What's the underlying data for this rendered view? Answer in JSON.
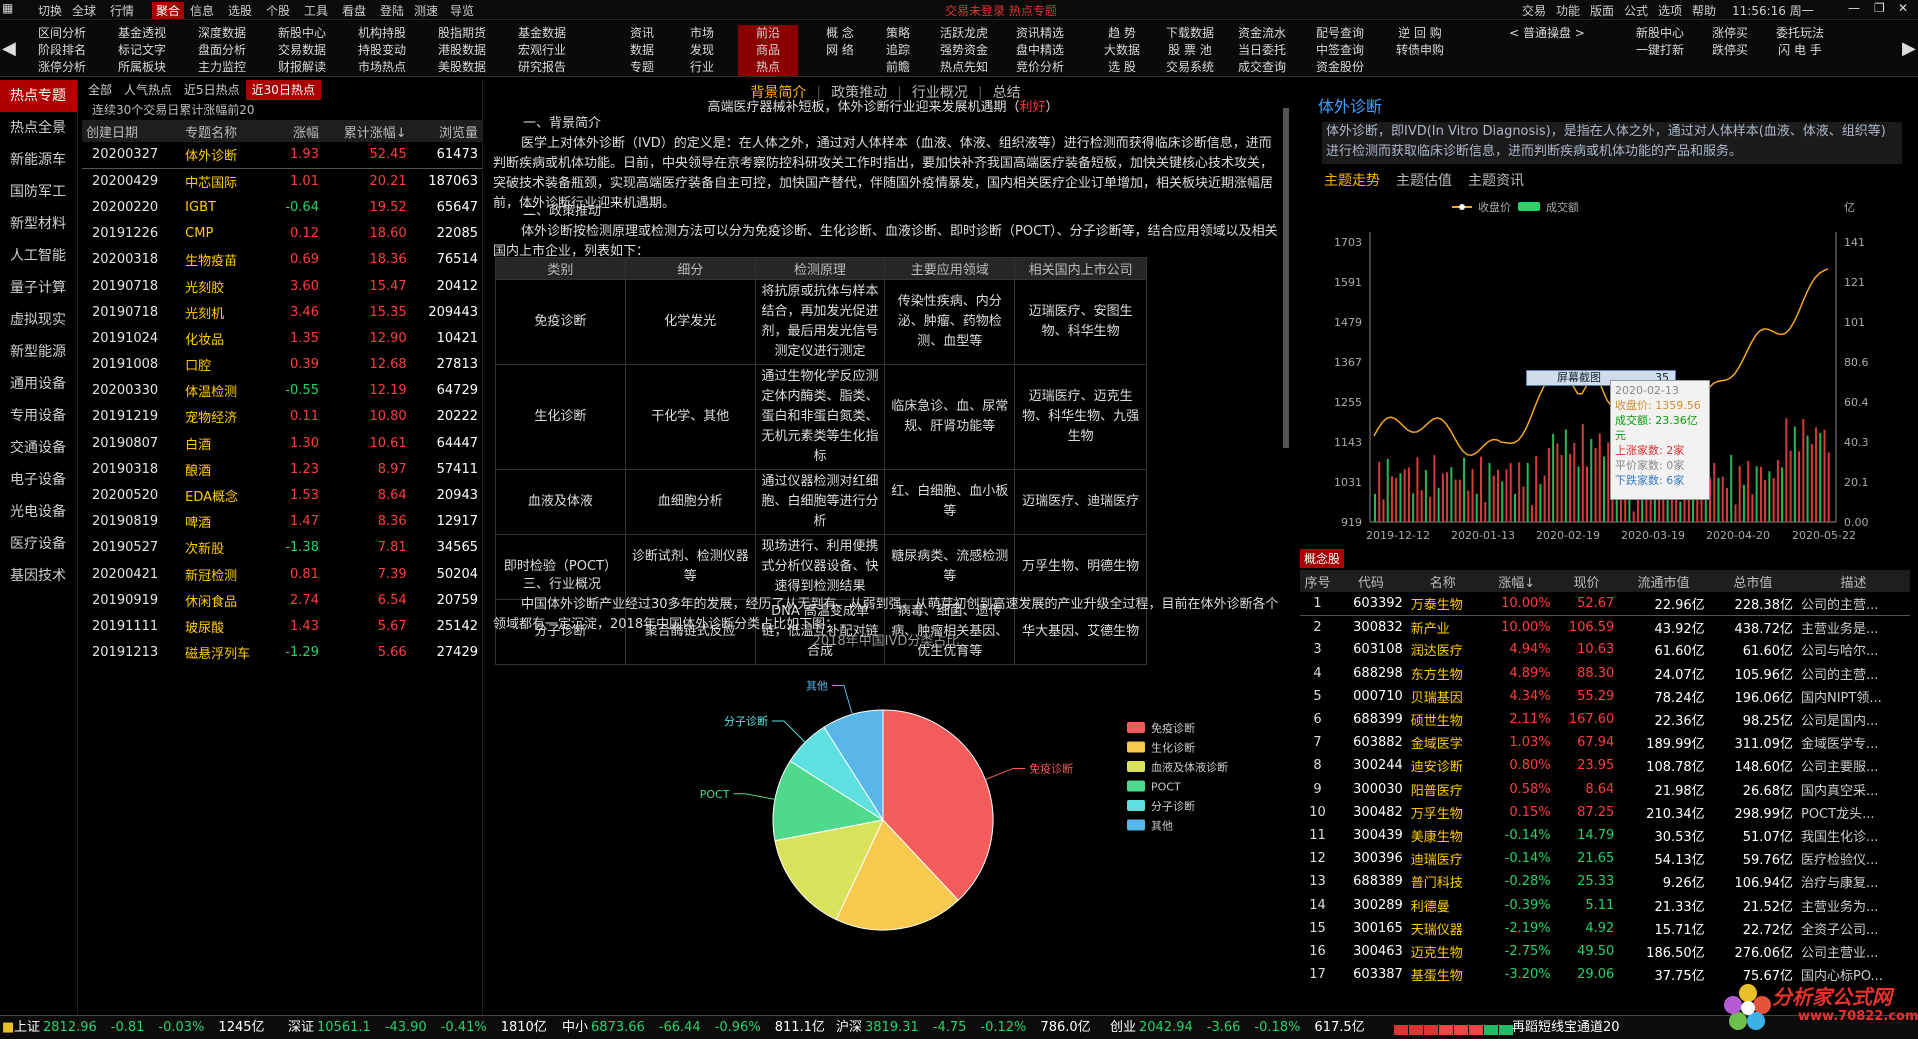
{
  "menubar": {
    "items": [
      "切换",
      "全球",
      "行情",
      "聚合",
      "信息",
      "选股",
      "个股",
      "工具",
      "看盘",
      "登陆",
      "测速",
      "导览"
    ],
    "active": 3,
    "center": "交易未登录  热点专题",
    "right": [
      "交易",
      "功能",
      "版面",
      "公式",
      "选项",
      "帮助"
    ],
    "clock": "11:56:16 周一"
  },
  "toolbar": {
    "columns": [
      [
        "区间分析",
        "阶段排名",
        "涨停分析"
      ],
      [
        "基金透视",
        "标记文字",
        "所属板块"
      ],
      [
        "深度数据",
        "盘面分析",
        "主力监控"
      ],
      [
        "新股中心",
        "交易数据",
        "财报解读"
      ],
      [
        "机构持股",
        "持股变动",
        "市场热点"
      ],
      [
        "股指期货",
        "港股数据",
        "美股数据"
      ],
      [
        "基金数据",
        "宏观行业",
        "研究报告"
      ],
      [
        "资讯",
        "数据",
        "专题"
      ],
      [
        "市场",
        "发现",
        "行业"
      ],
      [
        "前沿",
        "商品",
        "热点"
      ],
      [
        "概 念",
        "网 络",
        ""
      ],
      [
        "策略",
        "追踪",
        "前瞻"
      ],
      [
        "活跃龙虎",
        "强势资金",
        "热点先知"
      ],
      [
        "资讯精选",
        "盘中精选",
        "竞价分析"
      ],
      [
        "趋 势",
        "大数据",
        "选 股"
      ],
      [
        "下载数据",
        "股 票 池",
        "交易系统"
      ],
      [
        "资金流水",
        "当日委托",
        "成交查询"
      ],
      [
        "配号查询",
        "中签查询",
        "资金股份"
      ],
      [
        "逆 回 购",
        "转债申购",
        ""
      ],
      [
        "< 普通操盘 >",
        "",
        ""
      ],
      [
        "新股中心",
        "一键打新",
        ""
      ],
      [
        "涨停买",
        "跌停买",
        ""
      ],
      [
        "委托玩法",
        "闪 电 手",
        ""
      ]
    ],
    "hot_label": "热点"
  },
  "leftnav": {
    "items": [
      "热点专题",
      "热点全景",
      "新能源车",
      "国防军工",
      "新型材料",
      "人工智能",
      "量子计算",
      "虚拟现实",
      "新型能源",
      "通用设备",
      "专用设备",
      "交通设备",
      "电子设备",
      "光电设备",
      "医疗设备",
      "基因技术"
    ],
    "active": 0
  },
  "topics": {
    "tabs": [
      "全部",
      "人气热点",
      "近5日热点",
      "近30日热点"
    ],
    "active_tab": 3,
    "caption": "连续30个交易日累计涨幅前20",
    "headers": [
      "创建日期",
      "专题名称",
      "涨幅",
      "累计涨幅↓",
      "浏览量"
    ],
    "rows": [
      [
        "20200327",
        "体外诊断",
        "1.93",
        "52.45",
        "61473"
      ],
      [
        "20200429",
        "中芯国际",
        "1.01",
        "20.21",
        "187063"
      ],
      [
        "20200220",
        "IGBT",
        "-0.64",
        "19.52",
        "65647"
      ],
      [
        "20191226",
        "CMP",
        "0.12",
        "18.60",
        "22085"
      ],
      [
        "20200318",
        "生物疫苗",
        "0.69",
        "18.36",
        "76514"
      ],
      [
        "20190718",
        "光刻胶",
        "3.60",
        "15.47",
        "20412"
      ],
      [
        "20190718",
        "光刻机",
        "3.46",
        "15.35",
        "209443"
      ],
      [
        "20191024",
        "化妆品",
        "1.35",
        "12.90",
        "10421"
      ],
      [
        "20191008",
        "口腔",
        "0.39",
        "12.68",
        "27813"
      ],
      [
        "20200330",
        "体温检测",
        "-0.55",
        "12.19",
        "64729"
      ],
      [
        "20191219",
        "宠物经济",
        "0.11",
        "10.80",
        "20222"
      ],
      [
        "20190807",
        "白酒",
        "1.30",
        "10.61",
        "64447"
      ],
      [
        "20190318",
        "酿酒",
        "1.23",
        "8.97",
        "57411"
      ],
      [
        "20200520",
        "EDA概念",
        "1.53",
        "8.64",
        "20943"
      ],
      [
        "20190819",
        "啤酒",
        "1.47",
        "8.36",
        "12917"
      ],
      [
        "20190527",
        "次新股",
        "-1.38",
        "7.81",
        "34565"
      ],
      [
        "20200421",
        "新冠检测",
        "0.81",
        "7.39",
        "50204"
      ],
      [
        "20190919",
        "休闲食品",
        "2.74",
        "6.54",
        "20759"
      ],
      [
        "20191111",
        "玻尿酸",
        "1.43",
        "5.67",
        "25142"
      ],
      [
        "20191213",
        "磁悬浮列车",
        "-1.29",
        "5.66",
        "27429"
      ]
    ]
  },
  "article": {
    "tabs": [
      "背景简介",
      "政策推动",
      "行业概况",
      "总结"
    ],
    "active_tab": 0,
    "headline": "高端医疗器械补短板，体外诊断行业迎来发展机遇期（",
    "headline_tag": "利好",
    "headline_end": "）",
    "s1": "一、背景简介",
    "p1": "医学上对体外诊断（IVD）的定义是：在人体之外，通过对人体样本（血液、体液、组织液等）进行检测而获得临床诊断信息，进而判断疾病或机体功能。日前，中央领导在京考察防控科研攻关工作时指出，要加快补齐我国高端医疗装备短板，加快关键核心技术攻关，突破技术装备瓶颈，实现高端医疗装备自主可控，加快国产替代，伴随国外疫情暴发，国内相关医疗企业订单增加，相关板块近期涨幅居前，体外诊断行业迎来机遇期。",
    "s2": "二、政策推动",
    "p2": "体外诊断按检测原理或检测方法可以分为免疫诊断、生化诊断、血液诊断、即时诊断（POCT）、分子诊断等，结合应用领域以及相关国内上市企业，列表如下：",
    "table_headers": [
      "类别",
      "细分",
      "检测原理",
      "主要应用领域",
      "相关国内上市公司"
    ],
    "table_rows": [
      [
        "免疫诊断",
        "化学发光",
        "将抗原或抗体与样本结合，再加发光促进剂，最后用发光信号测定仪进行测定",
        "传染性疾病、内分泌、肿瘤、药物检测、血型等",
        "迈瑞医疗、安图生物、科华生物"
      ],
      [
        "生化诊断",
        "干化学、其他",
        "通过生物化学反应测定体内酶类、脂类、蛋白和非蛋白氮类、无机元素类等生化指标",
        "临床急诊、血、尿常规、肝肾功能等",
        "迈瑞医疗、迈克生物、科华生物、九强生物"
      ],
      [
        "血液及体液",
        "血细胞分析",
        "通过仪器检测对红细胞、白细胞等进行分析",
        "红、白细胞、血小板等",
        "迈瑞医疗、迪瑞医疗"
      ],
      [
        "即时检验（POCT）",
        "诊断试剂、检测仪器等",
        "现场进行、利用便携式分析仪器设备、快速得到检测结果",
        "糖尿病类、流感检测等",
        "万孚生物、明德生物"
      ],
      [
        "分子诊断",
        "聚合酶链式反应",
        "DNA 高温变成单链，低温互补配对链合成",
        "病毒、细菌、遗传病、肿瘤相关基因、优生优育等",
        "华大基因、艾德生物"
      ]
    ],
    "s3": "三、行业概况",
    "p3": "中国体外诊断产业经过30多年的发展，经历了从无到有、从弱到强、从萌芽初创到高速发展的产业升级全过程，目前在体外诊断各个领域都有一定沉淀，2018年中国体外诊断分类占比如下图："
  },
  "chart_data": [
    {
      "type": "pie",
      "title": "2018年中国IVD分类占比",
      "categories": [
        "免疫诊断",
        "生化诊断",
        "血液及体液诊断",
        "POCT",
        "分子诊断",
        "其他"
      ],
      "values": [
        38,
        19,
        15,
        12,
        7,
        9
      ],
      "colors": [
        "#f45b5b",
        "#f7c94e",
        "#d8e25a",
        "#4fd98c",
        "#5fe0e0",
        "#58b7e8"
      ],
      "slice_labels": [
        "免疫诊断",
        "",
        "",
        "POCT",
        "分子诊断",
        "其他"
      ],
      "legend": "right"
    },
    {
      "type": "line",
      "title": "",
      "series": [
        {
          "name": "收盘价",
          "color": "#f5a623"
        },
        {
          "name": "成交额",
          "color": "#26d26a"
        }
      ],
      "x_ticks": [
        "2019-12-12",
        "2020-01-13",
        "2020-02-19",
        "2020-03-19",
        "2020-04-20",
        "2020-05-22"
      ],
      "y_left_ticks": [
        919,
        1031,
        1143,
        1255,
        1367,
        1479,
        1591,
        1703
      ],
      "y_right_ticks": [
        "0.00",
        "20.1",
        "40.3",
        "60.4",
        "80.6",
        "101",
        "121",
        "141"
      ],
      "y_right_unit": "亿",
      "ylim": [
        919,
        1703
      ],
      "y2lim": [
        0,
        141
      ]
    }
  ],
  "rightpanel": {
    "title": "体外诊断",
    "desc": "体外诊断，即IVD(In Vitro Diagnosis)，是指在人体之外，通过对人体样本(血液、体液、组织等)进行检测而获取临床诊断信息，进而判断疾病或机体功能的产品和服务。",
    "tabs": [
      "主题走势",
      "主题估值",
      "主题资讯"
    ],
    "active_tab": 0,
    "tooltip": {
      "date": "2020-02-13",
      "close": "收盘价: 1359.56",
      "amount": "成交额: 23.36亿元",
      "up": "上涨家数: 2家",
      "flat": "平价家数: 0家",
      "down": "下跌家数: 6家"
    },
    "screenshot_label": "屏幕截图",
    "screenshot_num": "35"
  },
  "concept": {
    "tag": "概念股",
    "headers": [
      "序号",
      "代码",
      "名称",
      "涨幅↓",
      "现价",
      "流通市值",
      "总市值",
      "描述"
    ],
    "rows": [
      [
        "1",
        "603392",
        "万泰生物",
        "10.00%",
        "52.67",
        "22.96亿",
        "228.38亿",
        "公司的主营..."
      ],
      [
        "2",
        "300832",
        "新产业",
        "10.00%",
        "106.59",
        "43.92亿",
        "438.72亿",
        "主营业务是..."
      ],
      [
        "3",
        "603108",
        "润达医疗",
        "4.94%",
        "10.63",
        "61.60亿",
        "61.60亿",
        "公司与哈尔..."
      ],
      [
        "4",
        "688298",
        "东方生物",
        "4.89%",
        "88.30",
        "24.07亿",
        "105.96亿",
        "公司的主营..."
      ],
      [
        "5",
        "000710",
        "贝瑞基因",
        "4.34%",
        "55.29",
        "78.24亿",
        "196.06亿",
        "国内NIPT领..."
      ],
      [
        "6",
        "688399",
        "硕世生物",
        "2.11%",
        "167.60",
        "22.36亿",
        "98.25亿",
        "公司是国内..."
      ],
      [
        "7",
        "603882",
        "金域医学",
        "1.03%",
        "67.94",
        "189.99亿",
        "311.09亿",
        "金域医学专..."
      ],
      [
        "8",
        "300244",
        "迪安诊断",
        "0.80%",
        "23.95",
        "108.78亿",
        "148.60亿",
        "公司主要服..."
      ],
      [
        "9",
        "300030",
        "阳普医疗",
        "0.58%",
        "8.64",
        "21.98亿",
        "26.68亿",
        "国内真空采..."
      ],
      [
        "10",
        "300482",
        "万孚生物",
        "0.15%",
        "87.25",
        "210.34亿",
        "298.99亿",
        "POCT龙头..."
      ],
      [
        "11",
        "300439",
        "美康生物",
        "-0.14%",
        "14.79",
        "30.53亿",
        "51.07亿",
        "我国生化诊..."
      ],
      [
        "12",
        "300396",
        "迪瑞医疗",
        "-0.14%",
        "21.65",
        "54.13亿",
        "59.76亿",
        "医疗检验仪..."
      ],
      [
        "13",
        "688389",
        "普门科技",
        "-0.28%",
        "25.33",
        "9.26亿",
        "106.94亿",
        "治疗与康复..."
      ],
      [
        "14",
        "300289",
        "利德曼",
        "-0.39%",
        "5.11",
        "21.33亿",
        "21.52亿",
        "主营业务为..."
      ],
      [
        "15",
        "300165",
        "天瑞仪器",
        "-2.19%",
        "4.92",
        "15.71亿",
        "22.72亿",
        "全资子公司..."
      ],
      [
        "16",
        "300463",
        "迈克生物",
        "-2.75%",
        "49.50",
        "186.50亿",
        "276.06亿",
        "公司主营业..."
      ],
      [
        "17",
        "603387",
        "基蛋生物",
        "-3.20%",
        "29.06",
        "37.75亿",
        "75.67亿",
        "国内心标PO..."
      ]
    ]
  },
  "statusbar": {
    "indexes": [
      {
        "name": "上证",
        "value": "2812.96",
        "chg": "-0.81",
        "pct": "-0.03%",
        "amt": "1245亿"
      },
      {
        "name": "深证",
        "value": "10561.1",
        "chg": "-43.90",
        "pct": "-0.41%",
        "amt": "1810亿"
      },
      {
        "name": "中小",
        "value": "6873.66",
        "chg": "-66.44",
        "pct": "-0.96%",
        "amt": "811.1亿"
      },
      {
        "name": "沪深",
        "value": "3819.31",
        "chg": "-4.75",
        "pct": "-0.12%",
        "amt": "786.0亿"
      },
      {
        "name": "创业",
        "value": "2042.94",
        "chg": "-3.66",
        "pct": "-0.18%",
        "amt": "617.5亿"
      }
    ],
    "message": "再蹈短线宝通道20"
  },
  "logo": {
    "text": "分析家公式网",
    "url": "www.70822.com"
  }
}
